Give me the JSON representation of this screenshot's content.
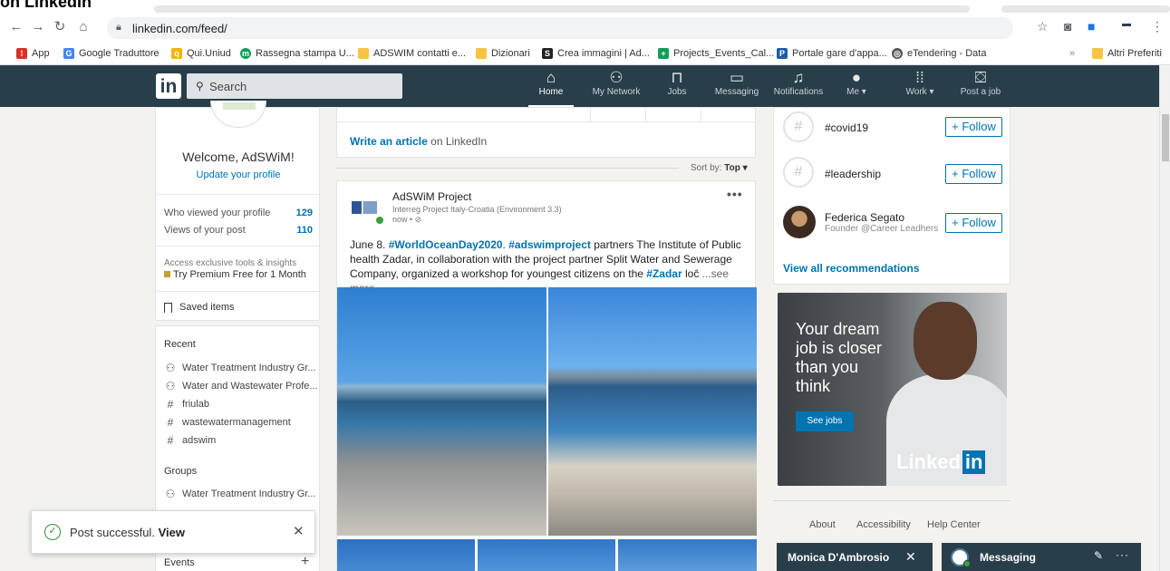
{
  "heading_fragment": "on LinkedIn",
  "browser": {
    "url": "linkedin.com/feed/",
    "bookmarks": [
      {
        "label": "App",
        "color": "#d93025"
      },
      {
        "label": "Google Traduttore",
        "color": "#4285f4"
      },
      {
        "label": "Qui.Uniud",
        "color": "#f4b400"
      },
      {
        "label": "Rassegna stampa U...",
        "color": "#0f9d58"
      },
      {
        "label": "ADSWIM contatti e...",
        "color": "#f6c344"
      },
      {
        "label": "Dizionari",
        "color": "#f6c344"
      },
      {
        "label": "Crea immagini | Ad...",
        "color": "#222222"
      },
      {
        "label": "Projects_Events_Cal...",
        "color": "#0f9d58"
      },
      {
        "label": "Portale gare d'appa...",
        "color": "#1a5da8"
      },
      {
        "label": "eTendering - Data",
        "color": "#555555"
      },
      {
        "label": "Altri Preferiti",
        "color": "#f6c344"
      }
    ]
  },
  "nav": {
    "logo": "in",
    "search_placeholder": "Search",
    "items": [
      {
        "label": "Home",
        "icon": "home-icon",
        "active": true
      },
      {
        "label": "My Network",
        "icon": "network-icon"
      },
      {
        "label": "Jobs",
        "icon": "jobs-icon"
      },
      {
        "label": "Messaging",
        "icon": "messaging-icon"
      },
      {
        "label": "Notifications",
        "icon": "bell-icon"
      },
      {
        "label": "Me ▾",
        "icon": "avatar-icon"
      },
      {
        "label": "Work ▾",
        "icon": "grid-icon"
      },
      {
        "label": "Post a job",
        "icon": "briefcase-icon"
      }
    ]
  },
  "profile": {
    "welcome": "Welcome, AdSWiM!",
    "update": "Update your profile",
    "stats": [
      {
        "label": "Who viewed your profile",
        "value": "129"
      },
      {
        "label": "Views of your post",
        "value": "110"
      }
    ],
    "premium_line1": "Access exclusive tools & insights",
    "premium_line2": "Try Premium Free for 1 Month",
    "saved": "Saved items"
  },
  "sidebar": {
    "recent_title": "Recent",
    "recent": [
      {
        "label": "Water Treatment Industry Gr...",
        "icon": "group-icon"
      },
      {
        "label": "Water and Wastewater Profe...",
        "icon": "group-icon"
      },
      {
        "label": "friulab",
        "icon": "hashtag-icon"
      },
      {
        "label": "wastewatermanagement",
        "icon": "hashtag-icon"
      },
      {
        "label": "adswim",
        "icon": "hashtag-icon"
      }
    ],
    "groups_title": "Groups",
    "groups": [
      {
        "label": "Water Treatment Industry Gr...",
        "icon": "group-icon"
      }
    ],
    "events_title": "Events"
  },
  "toast": {
    "text": "Post successful.",
    "link": "View"
  },
  "share": {
    "write_link": "Write an article",
    "write_rest": " on LinkedIn"
  },
  "sort": {
    "label": "Sort by:",
    "value": "Top ▾"
  },
  "post": {
    "author": "AdSWiM Project",
    "subtitle": "Interreg Project Italy-Croatia (Environment 3.3)",
    "time": "now • ⊘",
    "text_parts": [
      {
        "t": "June 8. ",
        "tag": false
      },
      {
        "t": "#WorldOceanDay2020",
        "tag": true
      },
      {
        "t": ".  ",
        "tag": false
      },
      {
        "t": "#adswimproject",
        "tag": true
      },
      {
        "t": " partners The Institute of Public health Zadar, in collaboration with the project partner Split Water and Sewerage Company, organized a workshop for youngest citizens on the ",
        "tag": false
      },
      {
        "t": "#Zadar",
        "tag": true
      },
      {
        "t": " loĉ",
        "tag": false
      }
    ],
    "see_more": " ...see more"
  },
  "recommendations": {
    "items": [
      {
        "name": "#covid19",
        "sub": "",
        "follow": "+ Follow"
      },
      {
        "name": "#leadership",
        "sub": "",
        "follow": "+ Follow"
      },
      {
        "name": "Federica Segato",
        "sub": "Founder @Career Leadhers",
        "follow": "+ Follow"
      }
    ],
    "view_all": "View all recommendations"
  },
  "ad": {
    "headline": "Your dream job is closer than you think",
    "button": "See jobs",
    "logo_a": "Linked",
    "logo_b": "in"
  },
  "footer": [
    "About",
    "Accessibility",
    "Help Center"
  ],
  "messaging": {
    "chat_name": "Monica D'Ambrosio",
    "label": "Messaging"
  }
}
